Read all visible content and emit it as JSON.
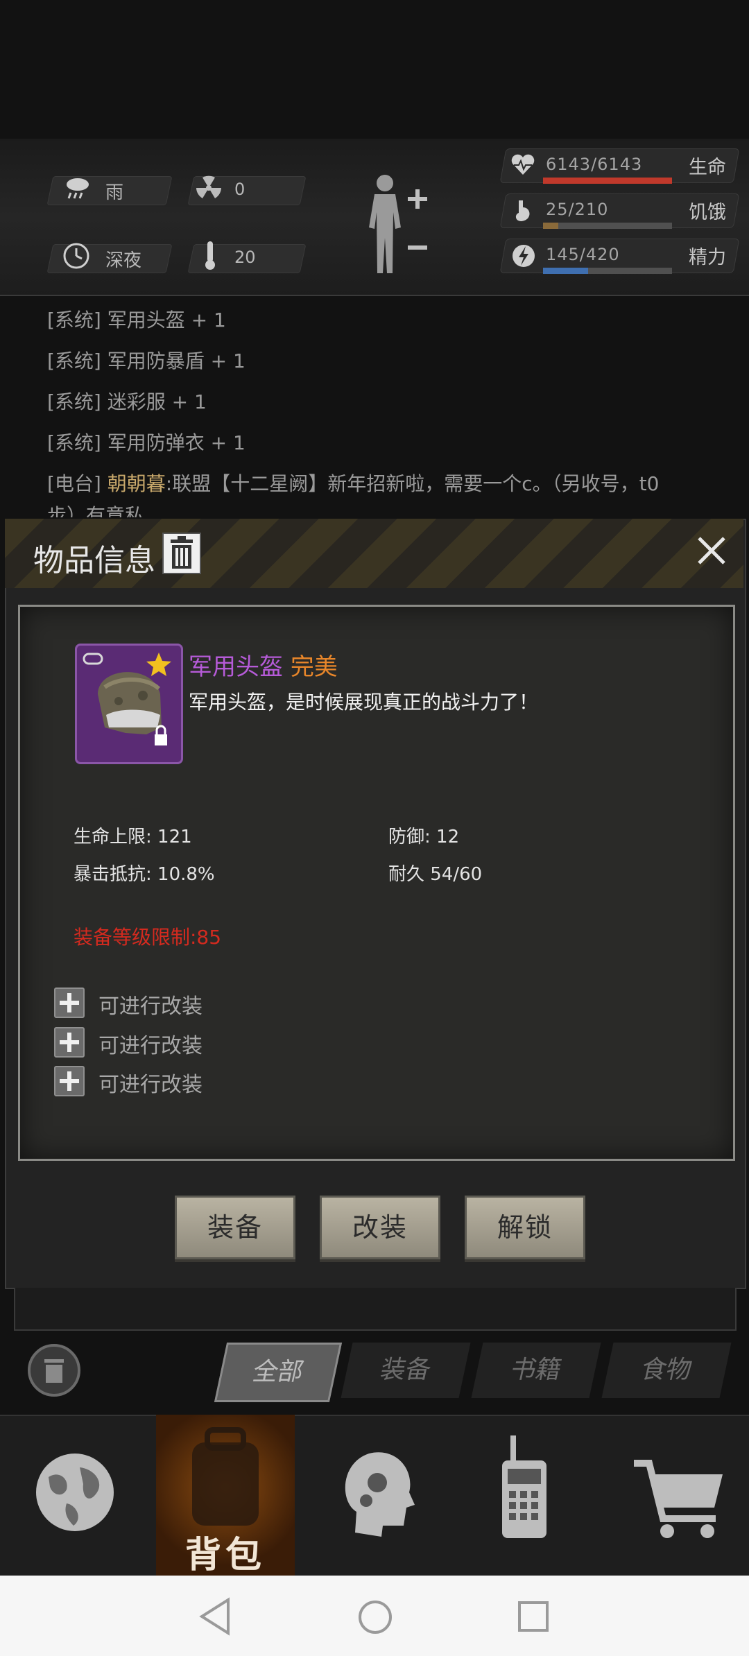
{
  "environment": {
    "weather": "雨",
    "radiation": "0",
    "time": "深夜",
    "temperature": "20"
  },
  "stats": [
    {
      "value": "6143/6143",
      "label": "生命",
      "fill": 1.0,
      "color": "#c0392b"
    },
    {
      "value": "25/210",
      "label": "饥饿",
      "fill": 0.12,
      "color": "#8a6a3a"
    },
    {
      "value": "145/420",
      "label": "精力",
      "fill": 0.35,
      "color": "#3f6fb0"
    }
  ],
  "log": [
    {
      "tag": "[系统]",
      "text": "军用头盔 + 1"
    },
    {
      "tag": "[系统]",
      "text": "军用防暴盾 + 1"
    },
    {
      "tag": "[系统]",
      "text": "迷彩服 + 1"
    },
    {
      "tag": "[系统]",
      "text": "军用防弹衣 + 1"
    },
    {
      "tag": "[电台]",
      "sender": "朝朝暮",
      "text": ":联盟【十二星阙】新年招新啦，需要一个c。（另收号，t0"
    },
    {
      "text": "步）有意私"
    }
  ],
  "modal": {
    "title": "物品信息",
    "item_name": "军用头盔",
    "quality": "完美",
    "description": "军用头盔，是时候展现真正的战斗力了！",
    "stats": {
      "hp": "生命上限: 121",
      "defense": "防御: 12",
      "crit_resist": "暴击抵抗: 10.8%",
      "durability": "耐久 54/60"
    },
    "level_requirement": "装备等级限制:85",
    "mod_slots": [
      "可进行改装",
      "可进行改装",
      "可进行改装"
    ],
    "buttons": {
      "equip": "装备",
      "modify": "改装",
      "unlock": "解锁"
    }
  },
  "tabs": [
    "全部",
    "装备",
    "书籍",
    "食物"
  ],
  "nav": {
    "backpack_label": "背包"
  },
  "colors": {
    "item_name": "#b65bd8",
    "quality": "#e8862a",
    "requirement": "#d42a1f"
  }
}
